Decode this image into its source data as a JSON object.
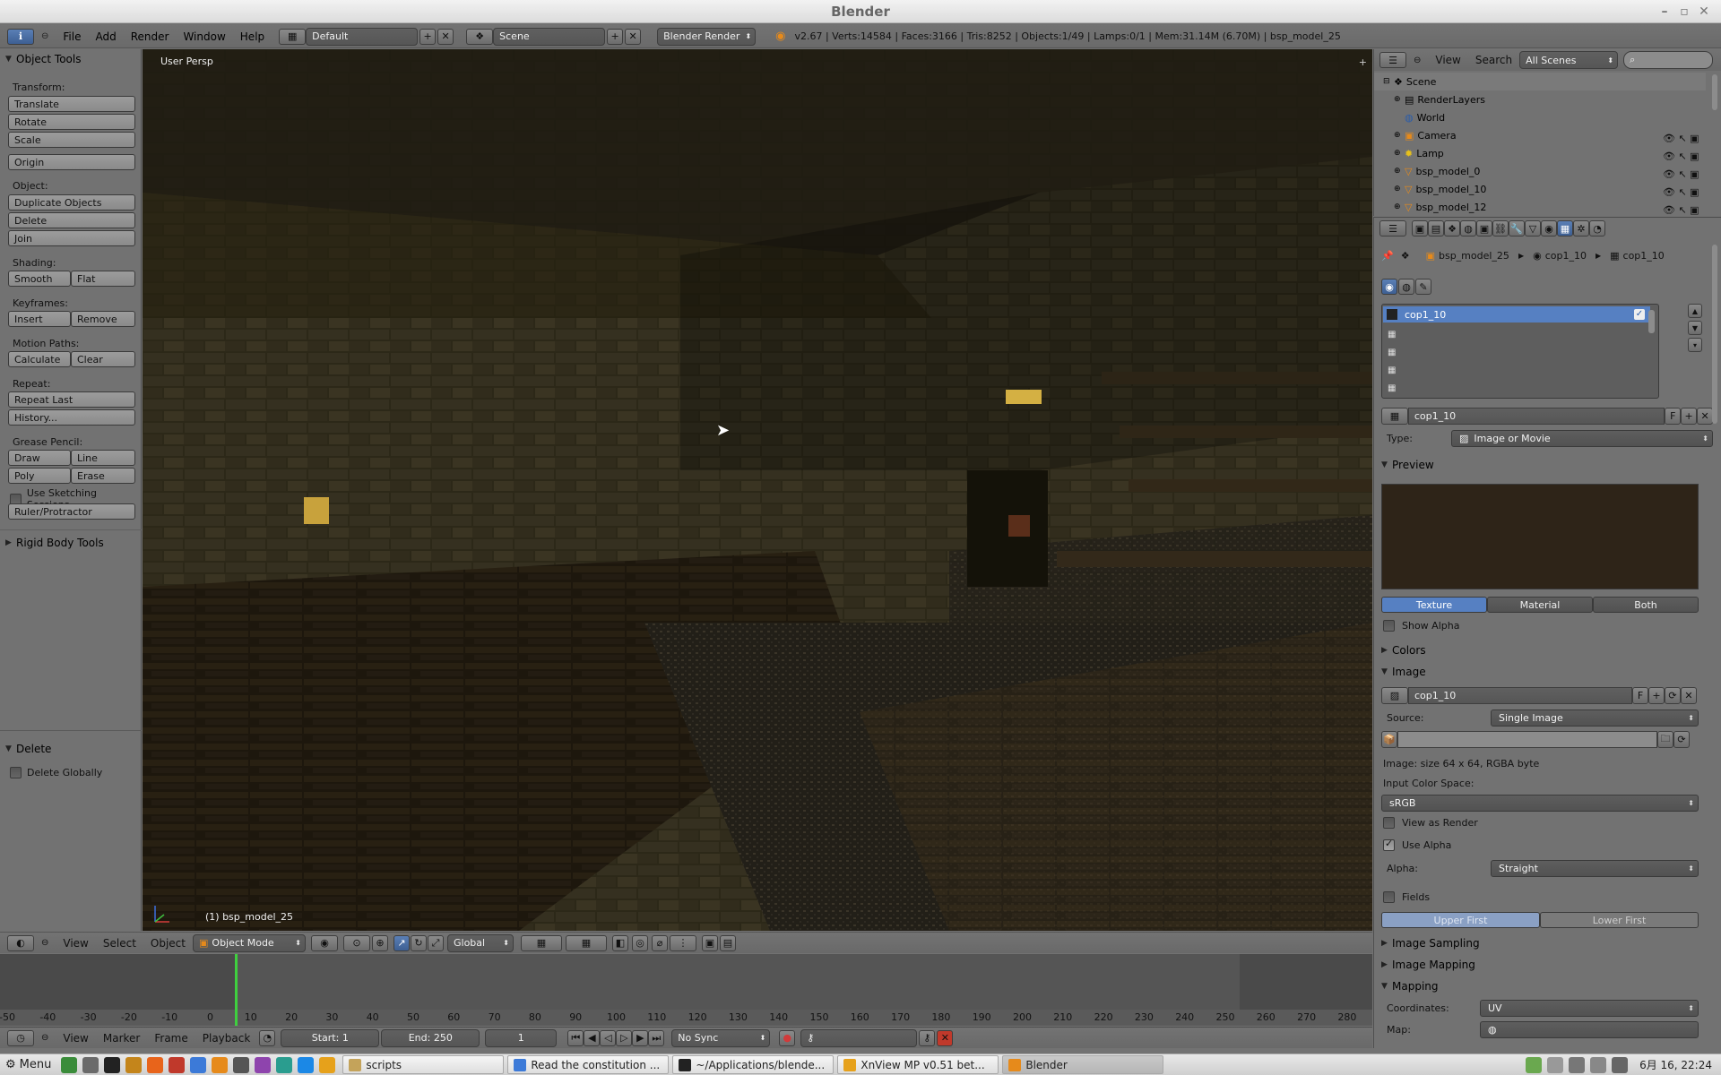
{
  "window": {
    "title": "Blender"
  },
  "info_header": {
    "menus": [
      "File",
      "Add",
      "Render",
      "Window",
      "Help"
    ],
    "layout": "Default",
    "scene": "Scene",
    "engine": "Blender Render",
    "stats": "v2.67 | Verts:14584 | Faces:3166 | Tris:8252 | Objects:1/49 | Lamps:0/1 | Mem:31.14M (6.70M) | bsp_model_25"
  },
  "tool_shelf": {
    "title": "Object Tools",
    "transform_label": "Transform:",
    "translate": "Translate",
    "rotate": "Rotate",
    "scale": "Scale",
    "origin": "Origin",
    "object_label": "Object:",
    "duplicate": "Duplicate Objects",
    "delete": "Delete",
    "join": "Join",
    "shading_label": "Shading:",
    "smooth": "Smooth",
    "flat": "Flat",
    "keyframes_label": "Keyframes:",
    "insert": "Insert",
    "remove": "Remove",
    "motion_label": "Motion Paths:",
    "calculate": "Calculate",
    "clear": "Clear",
    "repeat_label": "Repeat:",
    "repeat_last": "Repeat Last",
    "history": "History...",
    "grease_label": "Grease Pencil:",
    "draw": "Draw",
    "line": "Line",
    "poly": "Poly",
    "erase": "Erase",
    "sketching": "Use Sketching Sessions",
    "ruler": "Ruler/Protractor",
    "rigid_body": "Rigid Body Tools",
    "op_panel_title": "Delete",
    "delete_globally": "Delete Globally"
  },
  "viewport": {
    "view_name": "User Persp",
    "object_label": "(1) bsp_model_25"
  },
  "viewport_header": {
    "view": "View",
    "select": "Select",
    "object": "Object",
    "mode": "Object Mode",
    "orientation": "Global"
  },
  "timeline": {
    "ticks": [
      "-50",
      "-40",
      "-30",
      "-20",
      "-10",
      "0",
      "10",
      "20",
      "30",
      "40",
      "50",
      "60",
      "70",
      "80",
      "90",
      "100",
      "110",
      "120",
      "130",
      "140",
      "150",
      "160",
      "170",
      "180",
      "190",
      "200",
      "210",
      "220",
      "230",
      "240",
      "250",
      "260",
      "270",
      "280"
    ],
    "current_frame": 1,
    "view": "View",
    "marker": "Marker",
    "frame": "Frame",
    "playback": "Playback",
    "start": "Start: 1",
    "end": "End: 250",
    "frame_value": "1",
    "sync": "No Sync"
  },
  "outliner": {
    "view": "View",
    "search": "Search",
    "filter": "All Scenes",
    "items": [
      {
        "label": "Scene"
      },
      {
        "label": "RenderLayers"
      },
      {
        "label": "World"
      },
      {
        "label": "Camera"
      },
      {
        "label": "Lamp"
      },
      {
        "label": "bsp_model_0"
      },
      {
        "label": "bsp_model_10"
      },
      {
        "label": "bsp_model_12"
      }
    ]
  },
  "properties": {
    "breadcrumb": {
      "object": "bsp_model_25",
      "material": "cop1_10",
      "texture": "cop1_10"
    },
    "slot_selected": "cop1_10",
    "texture_name": "cop1_10",
    "type_label": "Type:",
    "type_value": "Image or Movie",
    "preview_title": "Preview",
    "preview_tabs": [
      "Texture",
      "Material",
      "Both"
    ],
    "show_alpha": "Show Alpha",
    "colors_title": "Colors",
    "image_title": "Image",
    "image_name": "cop1_10",
    "source_label": "Source:",
    "source_value": "Single Image",
    "image_info": "Image: size 64 x 64, RGBA byte",
    "color_space_label": "Input Color Space:",
    "color_space": "sRGB",
    "view_as_render": "View as Render",
    "use_alpha": "Use Alpha",
    "alpha_label": "Alpha:",
    "alpha_value": "Straight",
    "fields": "Fields",
    "field_order": [
      "Upper First",
      "Lower First"
    ],
    "image_sampling": "Image Sampling",
    "image_mapping": "Image Mapping",
    "mapping_title": "Mapping",
    "coordinates_label": "Coordinates:",
    "coordinates_value": "UV",
    "map_label": "Map:"
  },
  "taskbar": {
    "menu": "Menu",
    "tasks": [
      "scripts",
      "Read the constitution ...",
      "~/Applications/blende...",
      "XnView MP v0.51 bet...",
      "Blender"
    ],
    "clock": "6月 16, 22:24"
  },
  "colors": {
    "selection_blue": "#5680c2",
    "timeline_cursor": "#3fcf3f",
    "accent_orange": "#e68a1b"
  }
}
